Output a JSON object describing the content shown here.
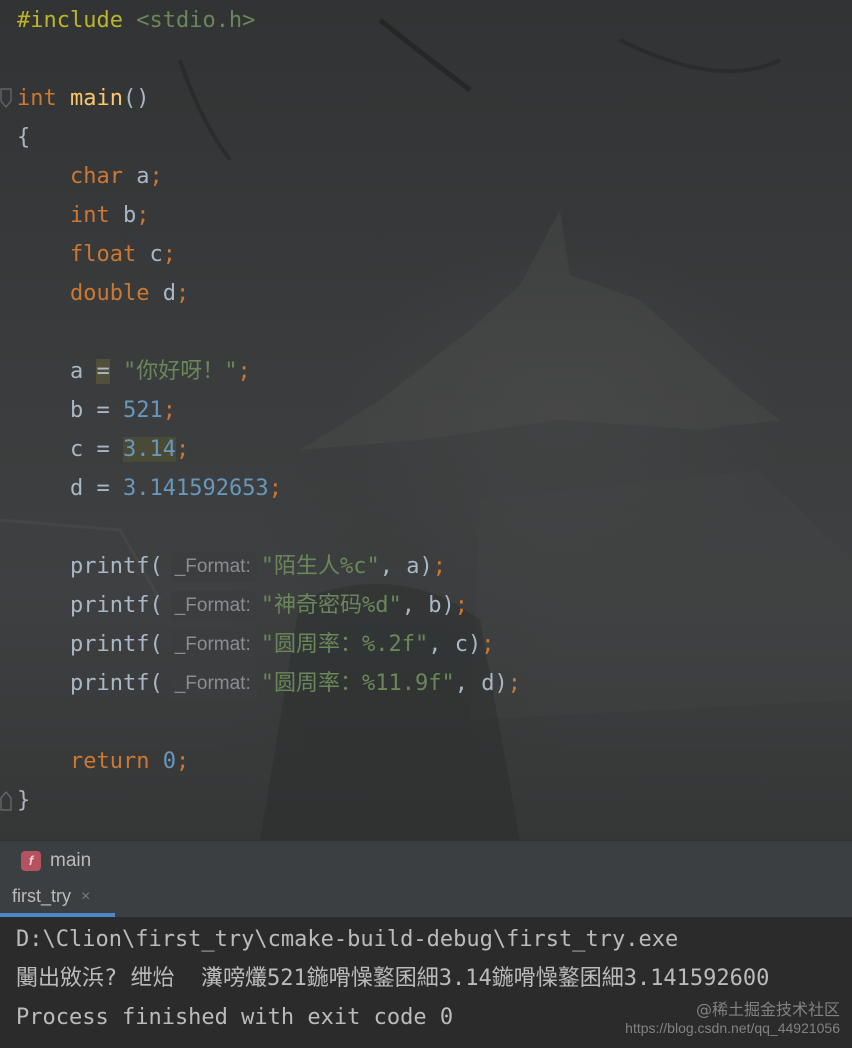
{
  "editor": {
    "lines": {
      "l1": {
        "directive": "#include",
        "header": "<stdio.h>"
      },
      "l3": {
        "type": "int",
        "name": "main",
        "parens": "()"
      },
      "l4": {
        "text": "{"
      },
      "l5": {
        "type": "char",
        "var": "a",
        "semi": ";"
      },
      "l6": {
        "type": "int",
        "var": "b",
        "semi": ";"
      },
      "l7": {
        "type": "float",
        "var": "c",
        "semi": ";"
      },
      "l8": {
        "type": "double",
        "var": "d",
        "semi": ";"
      },
      "l10": {
        "var": "a",
        "eq": "=",
        "value": "\"你好呀！\"",
        "semi": ";"
      },
      "l11": {
        "var": "b",
        "eq": " = ",
        "value": "521",
        "semi": ";"
      },
      "l12": {
        "var": "c",
        "eq": " = ",
        "value": "3.14",
        "semi": ";"
      },
      "l13": {
        "var": "d",
        "eq": " = ",
        "value": "3.141592653",
        "semi": ";"
      },
      "l15": {
        "fn": "printf(",
        "hint": "_Format:",
        "str": "\"陌生人%c\"",
        "rest": ", a)",
        "semi": ";"
      },
      "l16": {
        "fn": "printf(",
        "hint": "_Format:",
        "str": "\"神奇密码%d\"",
        "rest": ", b)",
        "semi": ";"
      },
      "l17": {
        "fn": "printf(",
        "hint": "_Format:",
        "str": "\"圆周率：%.2f\"",
        "rest": ", c)",
        "semi": ";"
      },
      "l18": {
        "fn": "printf(",
        "hint": "_Format:",
        "str": "\"圆周率：%11.9f\"",
        "rest": ", d)",
        "semi": ";"
      },
      "l20": {
        "kw": "return",
        "value": "0",
        "semi": ";"
      },
      "l21": {
        "text": "}"
      }
    }
  },
  "breadcrumb": {
    "badge": "f",
    "label": "main"
  },
  "run": {
    "tab_label": "first_try",
    "close_glyph": "×"
  },
  "console": {
    "line1": "D:\\Clion\\first_try\\cmake-build-debug\\first_try.exe",
    "line2": "闄出敓浜? 绁炲  瀵嗙爜521鍦嗗懆鐜囷細3.14鍦嗗懆鐜囷細3.141592600",
    "line3": "Process finished with exit code 0"
  },
  "watermarks": {
    "brand": "@稀土掘金技术社区",
    "url": "https://blog.csdn.net/qq_44921056"
  },
  "colors": {
    "keyword": "#cc7832",
    "function": "#ffc66d",
    "string": "#6a8759",
    "number": "#6897bb",
    "preprocessor": "#bbb529",
    "text": "#a9b7c6",
    "tab_underline": "#4a88c7",
    "badge": "#b4525f"
  }
}
